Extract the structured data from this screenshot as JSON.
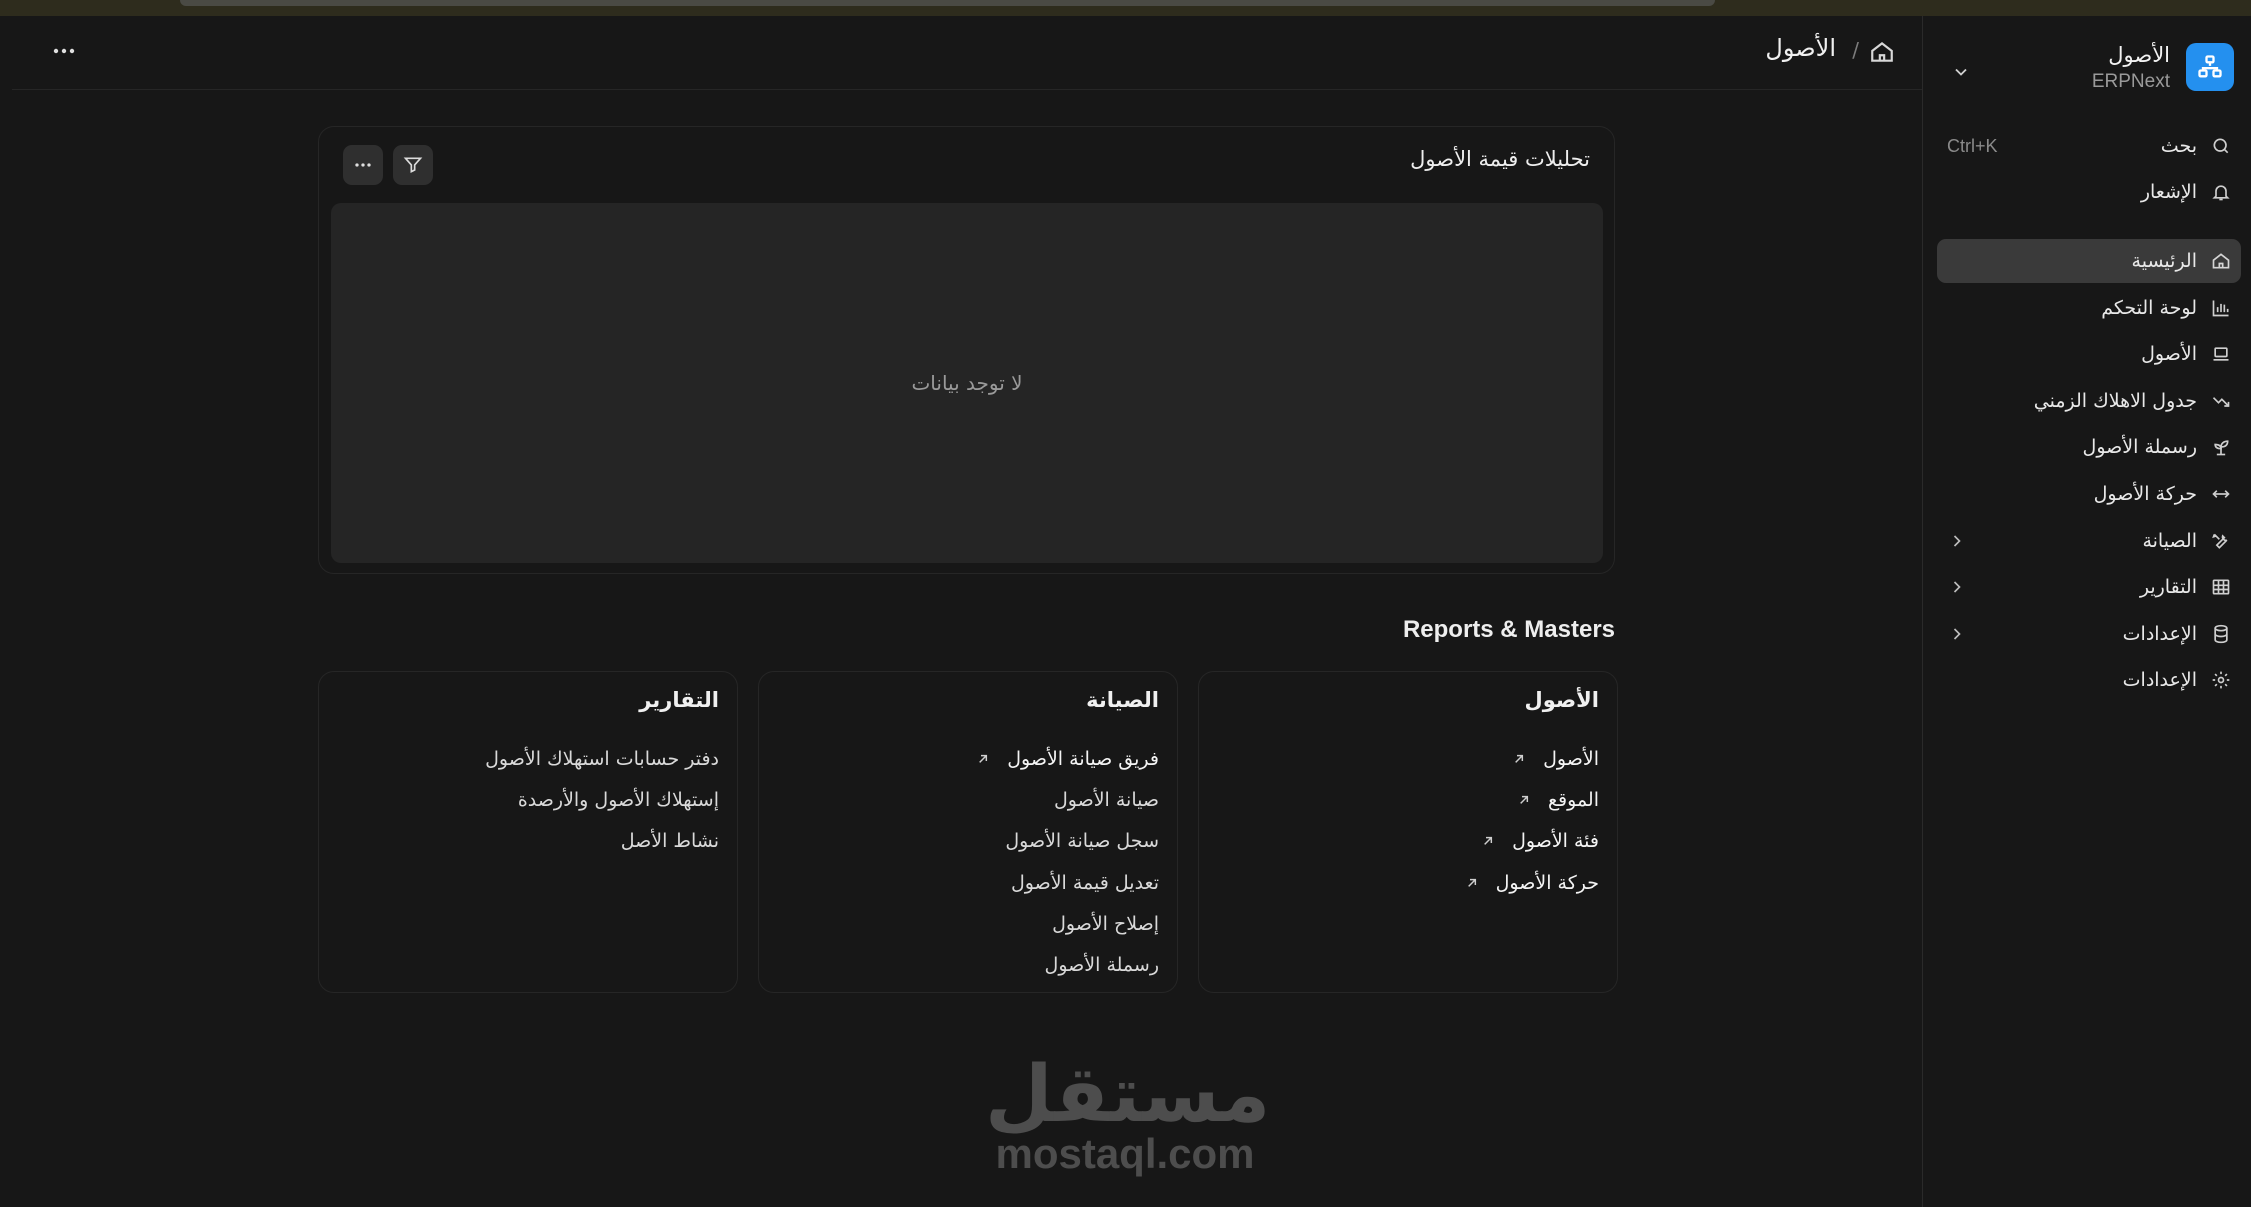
{
  "colors": {
    "accent": "#2490ef",
    "background": "#171717",
    "active_row": "#3a3a3a",
    "watermark": "#4d4d4d"
  },
  "sidebar": {
    "app_title": "الأصول",
    "app_subtitle": "ERPNext",
    "search": {
      "label": "بحث",
      "shortcut": "Ctrl+K",
      "icon": "search-icon"
    },
    "notifications": {
      "label": "الإشعار",
      "icon": "bell-icon"
    },
    "items": [
      {
        "label": "الرئيسية",
        "icon": "home-icon",
        "active": true
      },
      {
        "label": "لوحة التحكم",
        "icon": "bar-chart-icon"
      },
      {
        "label": "الأصول",
        "icon": "laptop-icon"
      },
      {
        "label": "جدول الاهلاك الزمني",
        "icon": "trend-down-icon"
      },
      {
        "label": "رسملة الأصول",
        "icon": "sprout-icon"
      },
      {
        "label": "حركة الأصول",
        "icon": "arrows-horizontal-icon"
      },
      {
        "label": "الصيانة",
        "icon": "tools-icon",
        "expandable": true
      },
      {
        "label": "التقارير",
        "icon": "table-icon",
        "expandable": true
      },
      {
        "label": "الإعدادات",
        "icon": "database-icon",
        "expandable": true
      },
      {
        "label": "الإعدادات",
        "icon": "gear-icon"
      }
    ]
  },
  "header": {
    "breadcrumb_separator": "/",
    "title": "الأصول"
  },
  "chart_card": {
    "title": "تحليلات قيمة الأصول",
    "empty_message": "لا توجد بيانات"
  },
  "reports_section": {
    "heading": "Reports & Masters",
    "cards": [
      {
        "title": "الأصول",
        "links": [
          {
            "label": "الأصول",
            "arrow": true
          },
          {
            "label": "الموقع",
            "arrow": true
          },
          {
            "label": "فئة الأصول",
            "arrow": true
          },
          {
            "label": "حركة الأصول",
            "arrow": true
          }
        ]
      },
      {
        "title": "الصيانة",
        "links": [
          {
            "label": "فريق صيانة الأصول",
            "arrow": true
          },
          {
            "label": "صيانة الأصول"
          },
          {
            "label": "سجل صيانة الأصول"
          },
          {
            "label": "تعديل قيمة الأصول"
          },
          {
            "label": "إصلاح الأصول"
          },
          {
            "label": "رسملة الأصول"
          }
        ]
      },
      {
        "title": "التقارير",
        "links": [
          {
            "label": "دفتر حسابات استهلاك الأصول"
          },
          {
            "label": "إستهلاك الأصول والأرصدة"
          },
          {
            "label": "نشاط الأصل"
          }
        ]
      }
    ]
  },
  "watermark": {
    "arabic": "مستقل",
    "latin": "mostaql.com"
  }
}
